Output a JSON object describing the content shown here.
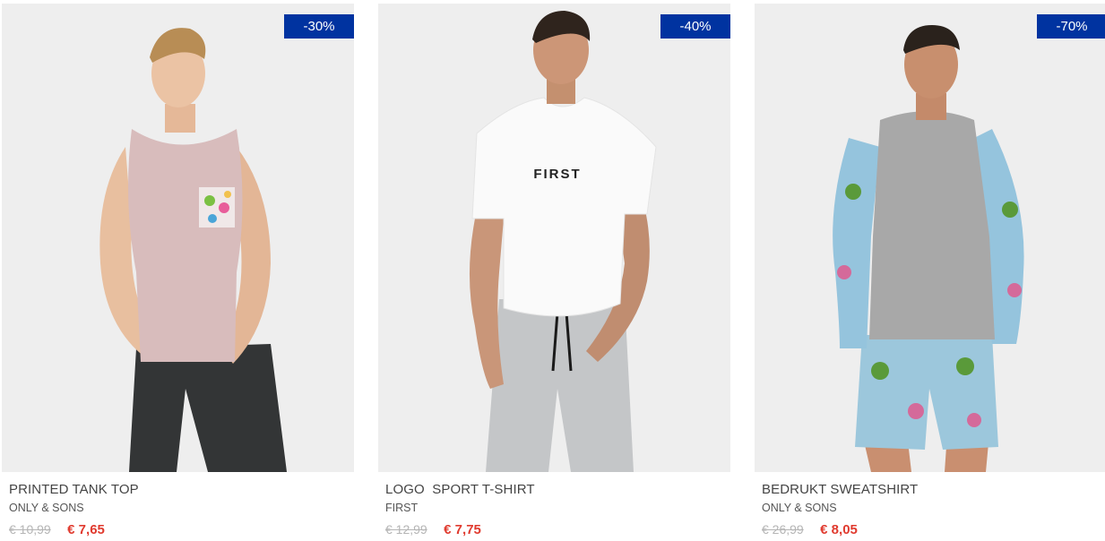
{
  "products": [
    {
      "name": "PRINTED TANK TOP",
      "brand": "ONLY & SONS",
      "old_price": "€ 10,99",
      "new_price": "€ 7,65",
      "discount": "-30%"
    },
    {
      "name": "LOGO  SPORT T-SHIRT",
      "brand": "FIRST",
      "old_price": "€ 12,99",
      "new_price": "€ 7,75",
      "discount": "-40%",
      "shirt_print": "FIRST"
    },
    {
      "name": "BEDRUKT SWEATSHIRT",
      "brand": "ONLY & SONS",
      "old_price": "€ 26,99",
      "new_price": "€ 8,05",
      "discount": "-70%"
    }
  ],
  "colors": {
    "badge": "#0033a0",
    "sale_price": "#e03a2e",
    "old_price": "#b5b5b5",
    "image_bg": "#eeeeee"
  }
}
